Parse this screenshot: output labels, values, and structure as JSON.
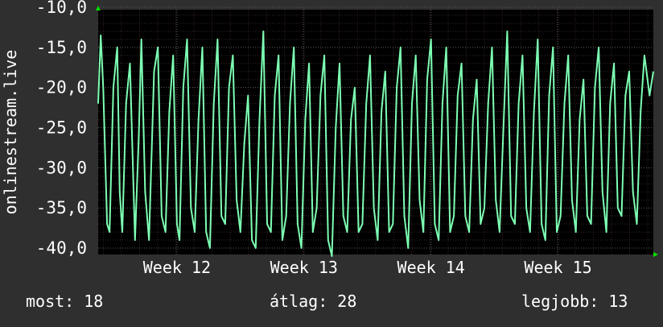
{
  "chart_data": {
    "type": "line",
    "ylabel": "onlinestream.live",
    "xlabel": "",
    "ylim": [
      -40.8,
      -10.3
    ],
    "xlim": [
      11.38,
      15.75
    ],
    "y_ticks": [
      "-10,0",
      "-15,0",
      "-20,0",
      "-25,0",
      "-30,0",
      "-35,0",
      "-40,0"
    ],
    "y_tick_values": [
      -10,
      -15,
      -20,
      -25,
      -30,
      -35,
      -40
    ],
    "x_ticks": [
      "Week 12",
      "Week 13",
      "Week 14",
      "Week 15"
    ],
    "x_tick_values": [
      12,
      13,
      14,
      15
    ],
    "grid": true,
    "series": [
      {
        "color": "#7dffb3",
        "x": [
          11.38,
          11.4,
          11.42,
          11.45,
          11.47,
          11.5,
          11.53,
          11.55,
          11.57,
          11.6,
          11.63,
          11.67,
          11.7,
          11.72,
          11.75,
          11.78,
          11.82,
          11.85,
          11.88,
          11.91,
          11.94,
          11.97,
          12.0,
          12.02,
          12.05,
          12.08,
          12.11,
          12.14,
          12.17,
          12.2,
          12.23,
          12.26,
          12.29,
          12.32,
          12.35,
          12.38,
          12.41,
          12.44,
          12.47,
          12.5,
          12.53,
          12.56,
          12.59,
          12.62,
          12.65,
          12.68,
          12.71,
          12.74,
          12.77,
          12.8,
          12.83,
          12.86,
          12.89,
          12.92,
          12.95,
          12.98,
          13.01,
          13.04,
          13.07,
          13.1,
          13.13,
          13.16,
          13.19,
          13.22,
          13.25,
          13.28,
          13.31,
          13.34,
          13.37,
          13.4,
          13.43,
          13.46,
          13.49,
          13.52,
          13.55,
          13.58,
          13.61,
          13.64,
          13.67,
          13.7,
          13.73,
          13.76,
          13.79,
          13.82,
          13.85,
          13.88,
          13.91,
          13.94,
          13.97,
          14.0,
          14.03,
          14.06,
          14.09,
          14.12,
          14.15,
          14.18,
          14.21,
          14.24,
          14.27,
          14.3,
          14.33,
          14.36,
          14.39,
          14.42,
          14.45,
          14.48,
          14.51,
          14.54,
          14.57,
          14.6,
          14.63,
          14.66,
          14.69,
          14.72,
          14.75,
          14.78,
          14.81,
          14.84,
          14.87,
          14.9,
          14.93,
          14.96,
          14.99,
          15.02,
          15.05,
          15.08,
          15.11,
          15.14,
          15.17,
          15.2,
          15.23,
          15.26,
          15.29,
          15.32,
          15.35,
          15.38,
          15.41,
          15.44,
          15.47,
          15.5,
          15.53,
          15.56,
          15.59,
          15.62,
          15.65,
          15.68,
          15.72,
          15.75
        ],
        "y": [
          -22,
          -13.5,
          -20,
          -37,
          -38,
          -20,
          -15,
          -33,
          -38,
          -22,
          -17,
          -39,
          -26,
          -14,
          -33,
          -39,
          -18,
          -15,
          -36,
          -38,
          -23,
          -16,
          -37,
          -39,
          -20,
          -14,
          -35,
          -38,
          -24,
          -15,
          -38,
          -40,
          -22,
          -14,
          -36,
          -37,
          -20,
          -16,
          -34,
          -38,
          -27,
          -21,
          -39,
          -40,
          -24,
          -13,
          -37,
          -38,
          -21,
          -16,
          -39,
          -36,
          -22,
          -15,
          -37,
          -40,
          -24,
          -17,
          -38,
          -35,
          -21,
          -16,
          -39,
          -41,
          -25,
          -17,
          -36,
          -38,
          -24,
          -20,
          -38,
          -37,
          -22,
          -16,
          -35,
          -39,
          -23,
          -18,
          -38,
          -37,
          -20,
          -15,
          -36,
          -40,
          -22,
          -16,
          -34,
          -38,
          -19,
          -14,
          -37,
          -39,
          -22,
          -15,
          -38,
          -36,
          -21,
          -17,
          -36,
          -38,
          -24,
          -19,
          -37,
          -35,
          -22,
          -15,
          -34,
          -38,
          -25,
          -13,
          -36,
          -37,
          -22,
          -16,
          -35,
          -38,
          -23,
          -14,
          -37,
          -39,
          -21,
          -15,
          -38,
          -36,
          -22,
          -16,
          -34,
          -38,
          -24,
          -19,
          -36,
          -37,
          -20,
          -15,
          -33,
          -38,
          -22,
          -17,
          -35,
          -36,
          -21,
          -18,
          -33,
          -37,
          -23,
          -16,
          -21,
          -18
        ]
      }
    ]
  },
  "footer": {
    "now_label": "most:",
    "now_value": "18",
    "avg_label": "átlag:",
    "avg_value": "28",
    "best_label": "legjobb:",
    "best_value": "13"
  },
  "colors": {
    "background": "#2f2f2f",
    "plot_background": "#000000",
    "grid": "#5a5a5a",
    "line": "#7dffb3",
    "axis_arrow": "#00e000",
    "text": "#ffffff"
  }
}
